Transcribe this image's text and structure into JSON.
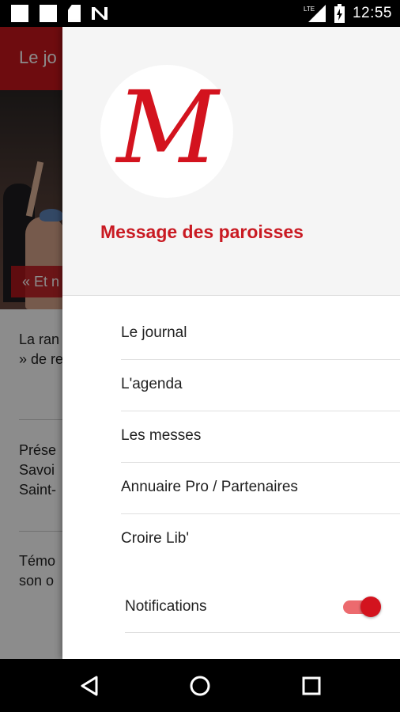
{
  "status_bar": {
    "time": "12:55",
    "network_label": "LTE"
  },
  "background_app": {
    "toolbar_title": "Le jo",
    "hero_caption": "« Et n",
    "articles": [
      {
        "lines": [
          "La ran",
          "» de re"
        ]
      },
      {
        "lines": [
          "Prése",
          "Savoi",
          "Saint-"
        ]
      },
      {
        "lines": [
          "Témo",
          "son o"
        ]
      }
    ]
  },
  "drawer": {
    "logo_letter": "M",
    "app_name": "Message des paroisses",
    "menu": [
      {
        "label": "Le journal"
      },
      {
        "label": "L'agenda"
      },
      {
        "label": "Les messes"
      },
      {
        "label": "Annuaire Pro / Partenaires"
      },
      {
        "label": "Croire Lib'"
      }
    ],
    "notifications": {
      "label": "Notifications",
      "enabled": true
    }
  },
  "colors": {
    "brand_red": "#d3131e",
    "toolbar_red": "#c8161d"
  },
  "icons": [
    "back-icon",
    "home-icon",
    "recents-icon"
  ]
}
